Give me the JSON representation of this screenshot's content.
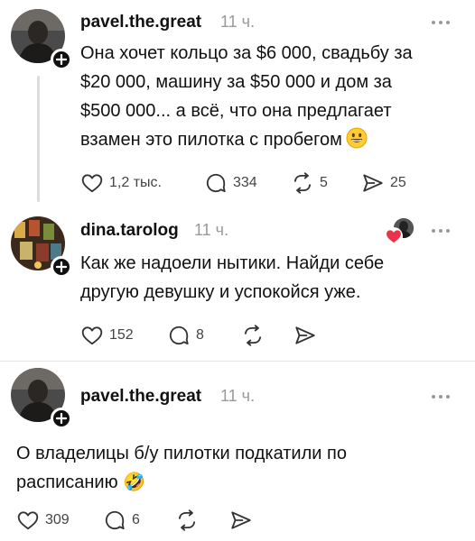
{
  "posts": [
    {
      "username": "pavel.the.great",
      "time": "11 ч.",
      "lines": [
        "Она хочет кольцо за $6 000, свадьбу за",
        "$20 000, машину за $50 000 и дом за",
        "$500 000... а всё, что она предлагает",
        "взамен это пилотка с пробегом"
      ],
      "emoji": "grinning-face-emoji",
      "likes": "1,2 тыс.",
      "comments": "334",
      "reposts": "5",
      "shares": "25"
    },
    {
      "username": "dina.tarolog",
      "time": "11 ч.",
      "lines": [
        "Как же надоели нытики. Найди себе",
        "другую девушку и успокойся уже."
      ],
      "likes": "152",
      "comments": "8"
    },
    {
      "username": "pavel.the.great",
      "time": "11 ч.",
      "lines": [
        "О владелицы б/у пилотки подкатили по",
        "расписанию 🤣"
      ],
      "likes": "309",
      "comments": "6"
    }
  ],
  "colors": {
    "text": "#111111",
    "muted": "#9a9a9a",
    "like_badge": "#e8344a"
  }
}
